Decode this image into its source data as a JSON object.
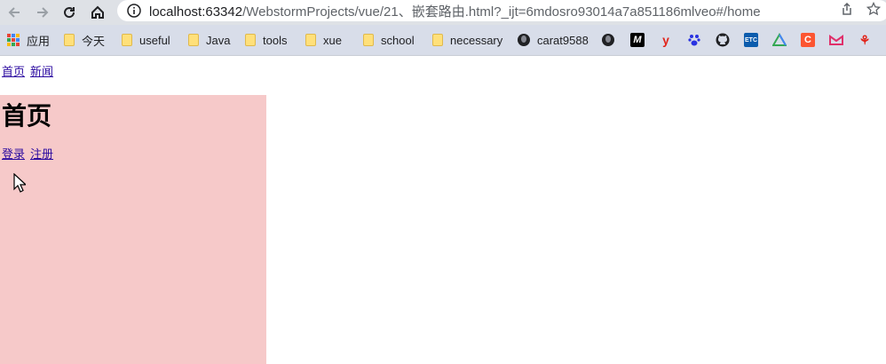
{
  "browser": {
    "url_host": "localhost:63342",
    "url_path": "/WebstormProjects/vue/21、嵌套路由.html?_ijt=6mdosro93014a7a851186mlveo#/home"
  },
  "bookmarks": [
    {
      "label": "应用",
      "icon": "apps-grid-icon"
    },
    {
      "label": "今天",
      "icon": "folder-icon"
    },
    {
      "label": "useful",
      "icon": "folder-icon"
    },
    {
      "label": "Java",
      "icon": "folder-icon"
    },
    {
      "label": "tools",
      "icon": "folder-icon"
    },
    {
      "label": "xue",
      "icon": "folder-icon"
    },
    {
      "label": "school",
      "icon": "folder-icon"
    },
    {
      "label": "necessary",
      "icon": "folder-icon"
    },
    {
      "label": "carat9588",
      "icon": "globe-icon"
    }
  ],
  "bookmark_icons": [
    "globe-icon",
    "M",
    "y",
    "paw-icon",
    "github-icon",
    "ETC",
    "triangle-icon",
    "C",
    "M",
    "bell-icon"
  ],
  "page": {
    "nav_home": "首页",
    "nav_news": "新闻",
    "home_title": "首页",
    "login": "登录",
    "register": "注册",
    "home_bg": "#f6c9c9",
    "link_color": "#2b0aa0"
  }
}
